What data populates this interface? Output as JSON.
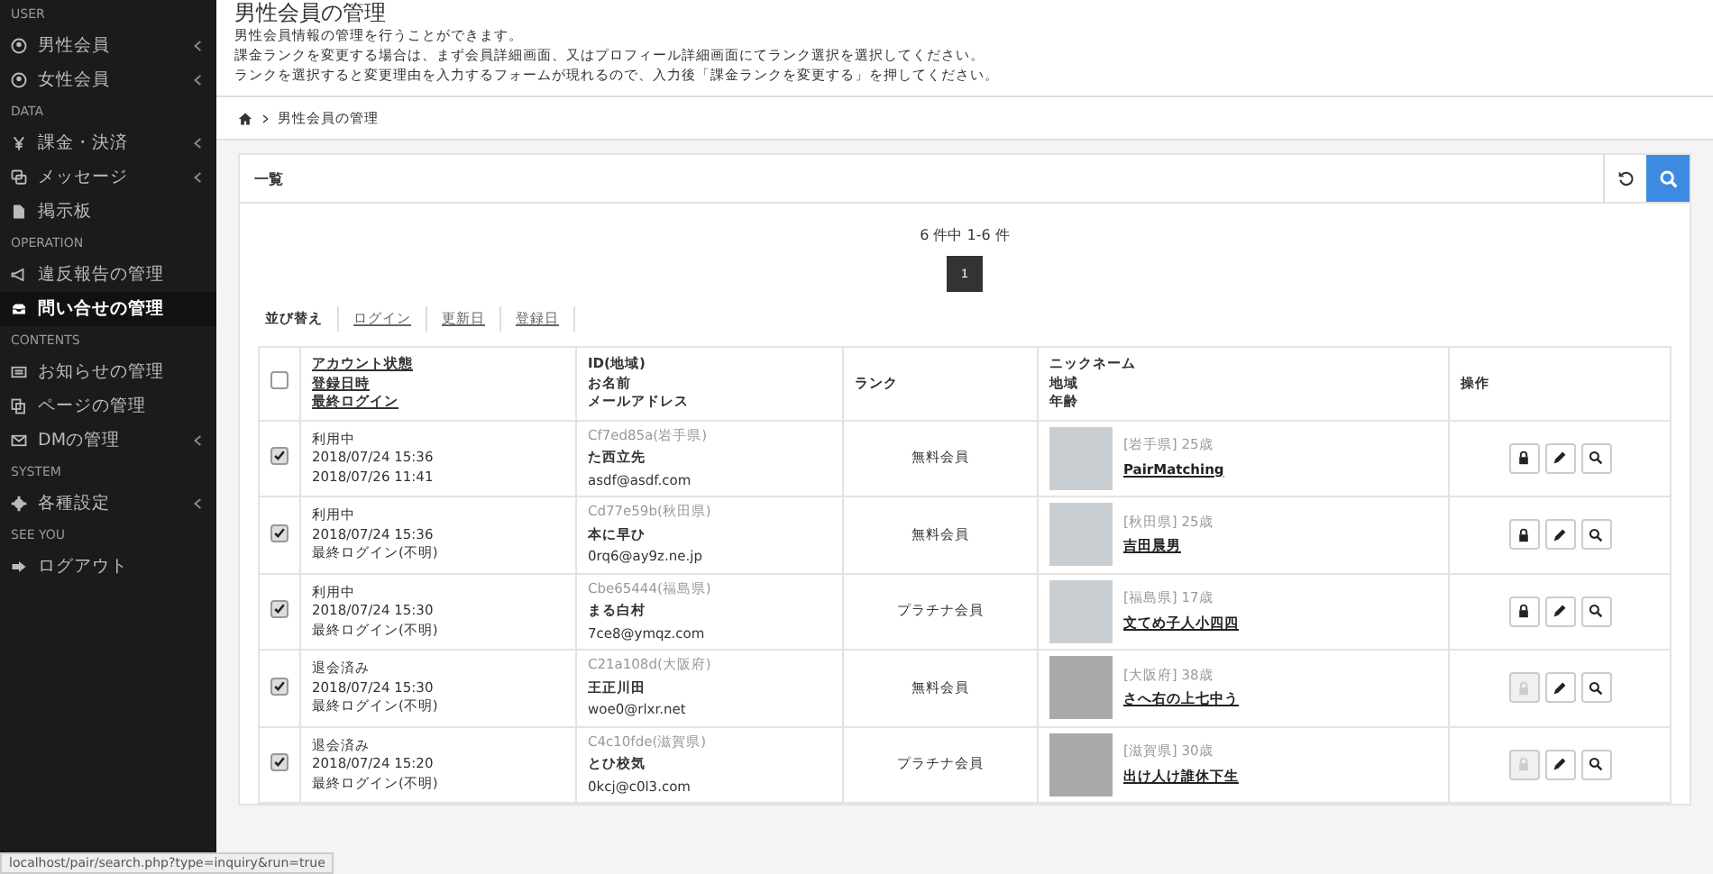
{
  "sidebar": [
    {
      "heading": "USER",
      "items": [
        {
          "label": "男性会員",
          "expandable": true,
          "selected": false
        },
        {
          "label": "女性会員",
          "expandable": true,
          "selected": false
        }
      ]
    },
    {
      "heading": "DATA",
      "items": [
        {
          "label": "課金・決済",
          "expandable": true,
          "selected": false
        },
        {
          "label": "メッセージ",
          "expandable": true,
          "selected": false
        },
        {
          "label": "掲示板",
          "expandable": false,
          "selected": false
        }
      ]
    },
    {
      "heading": "OPERATION",
      "items": [
        {
          "label": "違反報告の管理",
          "expandable": false,
          "selected": false
        },
        {
          "label": "問い合せの管理",
          "expandable": false,
          "selected": true
        }
      ]
    },
    {
      "heading": "CONTENTS",
      "items": [
        {
          "label": "お知らせの管理",
          "expandable": false,
          "selected": false
        },
        {
          "label": "ページの管理",
          "expandable": false,
          "selected": false
        },
        {
          "label": "DMの管理",
          "expandable": true,
          "selected": false
        }
      ]
    },
    {
      "heading": "SYSTEM",
      "items": [
        {
          "label": "各種設定",
          "expandable": true,
          "selected": false
        }
      ]
    },
    {
      "heading": "SEE YOU",
      "items": [
        {
          "label": "ログアウト",
          "expandable": false,
          "selected": false
        }
      ]
    }
  ],
  "page": {
    "title": "男性会員の管理",
    "description": [
      "男性会員情報の管理を行うことができます。",
      "課金ランクを変更する場合は、まず会員詳細画面、又はプロフィール詳細画面にてランク選択を選択してください。",
      "ランクを選択すると変更理由を入力するフォームが現れるので、入力後「課金ランクを変更する」を押してください。"
    ]
  },
  "breadcrumb": {
    "current": "男性会員の管理"
  },
  "panel": {
    "title": "一覧",
    "count": "6 件中 1-6 件",
    "pages": [
      {
        "label": "1",
        "selected": true
      }
    ]
  },
  "sort": {
    "label": "並び替え",
    "options": [
      "ログイン",
      "更新日",
      "登録日"
    ]
  },
  "table": {
    "columns": [
      [
        "アカウント状態",
        "登録日時",
        "最終ログイン"
      ],
      [
        "ID(地域)",
        "お名前",
        "メールアドレス"
      ],
      [
        "ランク"
      ],
      [
        "ニックネーム",
        "地域",
        "年齢"
      ],
      [
        "操作"
      ]
    ],
    "header_checked": false,
    "rows": [
      {
        "checked": true,
        "status": "利用中",
        "registered": "2018/07/24 15:36",
        "last_login": "2018/07/26 11:41",
        "id": "Cf7ed85a(岩手県)",
        "name": "た西立先",
        "email": "asdf@asdf.com",
        "rank": "無料会員",
        "has_photo": true,
        "region": "[岩手県]",
        "age": "25歳",
        "nickname": "PairMatching",
        "lock_disabled": false
      },
      {
        "checked": true,
        "status": "利用中",
        "registered": "2018/07/24 15:36",
        "last_login": "最終ログイン(不明)",
        "id": "Cd77e59b(秋田県)",
        "name": "本に早ひ",
        "email": "0rq6@ay9z.ne.jp",
        "rank": "無料会員",
        "has_photo": true,
        "region": "[秋田県]",
        "age": "25歳",
        "nickname": "吉田晨男",
        "lock_disabled": false
      },
      {
        "checked": true,
        "status": "利用中",
        "registered": "2018/07/24 15:30",
        "last_login": "最終ログイン(不明)",
        "id": "Cbe65444(福島県)",
        "name": "まる白村",
        "email": "7ce8@ymqz.com",
        "rank": "プラチナ会員",
        "has_photo": true,
        "region": "[福島県]",
        "age": "17歳",
        "nickname": "文てめ子人小四四",
        "lock_disabled": false
      },
      {
        "checked": true,
        "status": "退会済み",
        "registered": "2018/07/24 15:30",
        "last_login": "最終ログイン(不明)",
        "id": "C21a108d(大阪府)",
        "name": "王正川田",
        "email": "woe0@rlxr.net",
        "rank": "無料会員",
        "has_photo": false,
        "region": "[大阪府]",
        "age": "38歳",
        "nickname": "さへ右の上七中う",
        "lock_disabled": true
      },
      {
        "checked": true,
        "status": "退会済み",
        "registered": "2018/07/24 15:20",
        "last_login": "最終ログイン(不明)",
        "id": "C4c10fde(滋賀県)",
        "name": "とひ校気",
        "email": "0kcj@c0l3.com",
        "rank": "プラチナ会員",
        "has_photo": false,
        "region": "[滋賀県]",
        "age": "30歳",
        "nickname": "出け人け誰休下生",
        "lock_disabled": true
      }
    ]
  },
  "status_bar": "localhost/pair/search.php?type=inquiry&run=true"
}
